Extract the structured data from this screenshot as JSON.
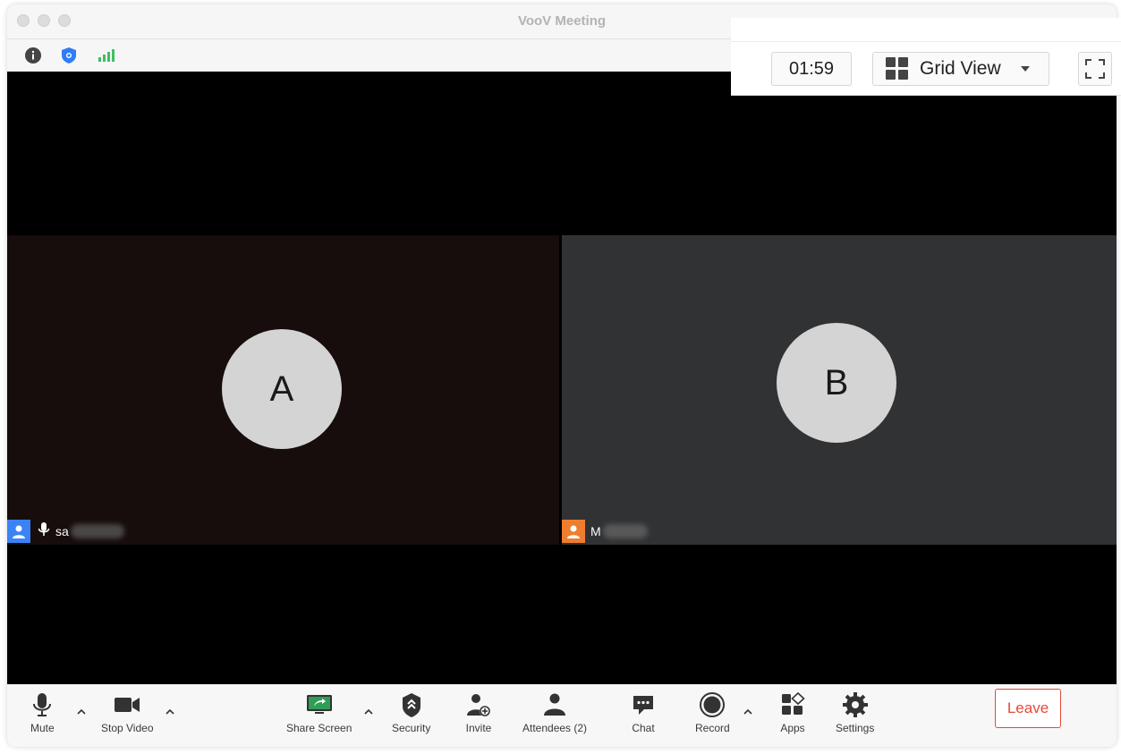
{
  "window": {
    "title": "VooV Meeting"
  },
  "topbar": {
    "timer": "01:59",
    "view_label": "Grid View"
  },
  "participants": [
    {
      "avatar_letter": "A",
      "name_visible": "sa"
    },
    {
      "avatar_letter": "B",
      "name_visible": "M"
    }
  ],
  "toolbar": {
    "mute": "Mute",
    "stop_video": "Stop Video",
    "share_screen": "Share Screen",
    "security": "Security",
    "invite": "Invite",
    "attendees": "Attendees (2)",
    "chat": "Chat",
    "record": "Record",
    "apps": "Apps",
    "settings": "Settings",
    "leave": "Leave"
  },
  "colors": {
    "leave_red": "#e44a3a",
    "security_blue": "#2f7df6",
    "signal_green": "#3fbf5f",
    "participant_a_badge": "#3b82f6",
    "participant_b_badge": "#ef7d2f"
  },
  "icons": {
    "info": "info-icon",
    "security_badge": "shield-icon",
    "signal": "signal-bars-icon",
    "grid": "grid-icon",
    "fullscreen": "fullscreen-icon"
  }
}
